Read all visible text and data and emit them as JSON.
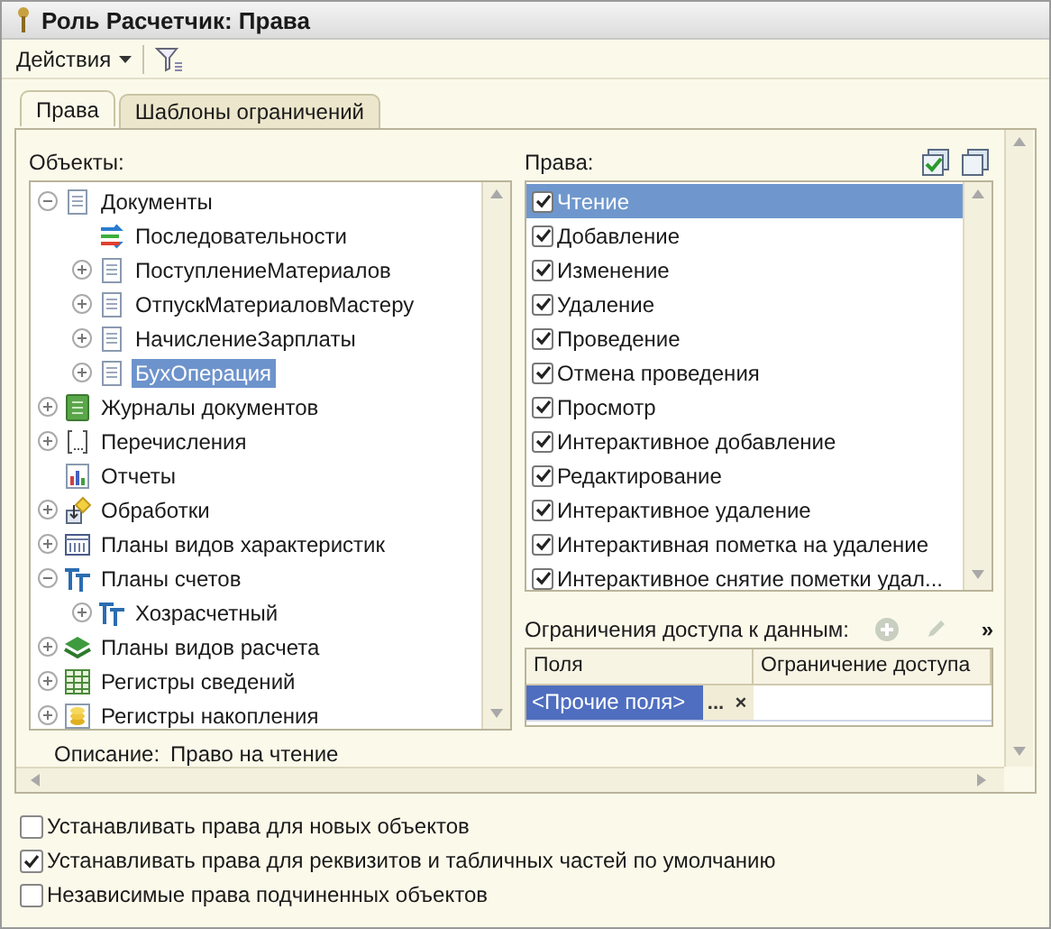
{
  "window": {
    "title": "Роль Расчетчик: Права"
  },
  "toolbar": {
    "actions_menu": "Действия"
  },
  "tabs": [
    {
      "label": "Права",
      "selected": true
    },
    {
      "label": "Шаблоны ограничений",
      "selected": false
    }
  ],
  "objects": {
    "label": "Объекты:",
    "tree": [
      {
        "label": "Документы",
        "kind": "documents",
        "expanded": true,
        "selected": false,
        "children": [
          {
            "label": "Последовательности",
            "kind": "sequence",
            "selected": false
          },
          {
            "label": "ПоступлениеМатериалов",
            "kind": "document",
            "expanded": false,
            "selected": false
          },
          {
            "label": "ОтпускМатериаловМастеру",
            "kind": "document",
            "expanded": false,
            "selected": false
          },
          {
            "label": "НачислениеЗарплаты",
            "kind": "document",
            "expanded": false,
            "selected": false
          },
          {
            "label": "БухОперация",
            "kind": "document",
            "expanded": false,
            "selected": true
          }
        ]
      },
      {
        "label": "Журналы документов",
        "kind": "journal",
        "expanded": false,
        "selected": false
      },
      {
        "label": "Перечисления",
        "kind": "enum",
        "expanded": false,
        "selected": false
      },
      {
        "label": "Отчеты",
        "kind": "report",
        "selected": false
      },
      {
        "label": "Обработки",
        "kind": "processing",
        "expanded": false,
        "selected": false
      },
      {
        "label": "Планы видов характеристик",
        "kind": "chars",
        "expanded": false,
        "selected": false
      },
      {
        "label": "Планы счетов",
        "kind": "accounts",
        "expanded": true,
        "selected": false,
        "children": [
          {
            "label": "Хозрасчетный",
            "kind": "accounts",
            "expanded": false,
            "selected": false
          }
        ]
      },
      {
        "label": "Планы видов расчета",
        "kind": "calc",
        "expanded": false,
        "selected": false
      },
      {
        "label": "Регистры сведений",
        "kind": "info_register",
        "expanded": false,
        "selected": false
      },
      {
        "label": "Регистры накопления",
        "kind": "accum_register",
        "expanded": false,
        "selected": false
      }
    ],
    "description_label": "Описание:",
    "description": "Право на чтение"
  },
  "rights": {
    "label": "Права:",
    "items": [
      {
        "label": "Чтение",
        "checked": true,
        "selected": true
      },
      {
        "label": "Добавление",
        "checked": true,
        "selected": false
      },
      {
        "label": "Изменение",
        "checked": true,
        "selected": false
      },
      {
        "label": "Удаление",
        "checked": true,
        "selected": false
      },
      {
        "label": "Проведение",
        "checked": true,
        "selected": false
      },
      {
        "label": "Отмена проведения",
        "checked": true,
        "selected": false
      },
      {
        "label": "Просмотр",
        "checked": true,
        "selected": false
      },
      {
        "label": "Интерактивное добавление",
        "checked": true,
        "selected": false
      },
      {
        "label": "Редактирование",
        "checked": true,
        "selected": false
      },
      {
        "label": "Интерактивное удаление",
        "checked": true,
        "selected": false
      },
      {
        "label": "Интерактивная пометка на удаление",
        "checked": true,
        "selected": false
      },
      {
        "label": "Интерактивное снятие пометки удал...",
        "checked": true,
        "selected": false
      }
    ]
  },
  "restrictions": {
    "label": "Ограничения доступа к данным:",
    "more": "»",
    "columns": [
      "Поля",
      "Ограничение доступа"
    ],
    "rows": [
      {
        "field": "<Прочие поля>",
        "selected": true
      }
    ],
    "ellipsis": "...",
    "clear": "×"
  },
  "options": [
    {
      "label": "Устанавливать права для новых объектов",
      "checked": false
    },
    {
      "label": "Устанавливать права для реквизитов и табличных частей по умолчанию",
      "checked": true
    },
    {
      "label": "Независимые права подчиненных объектов",
      "checked": false
    }
  ]
}
